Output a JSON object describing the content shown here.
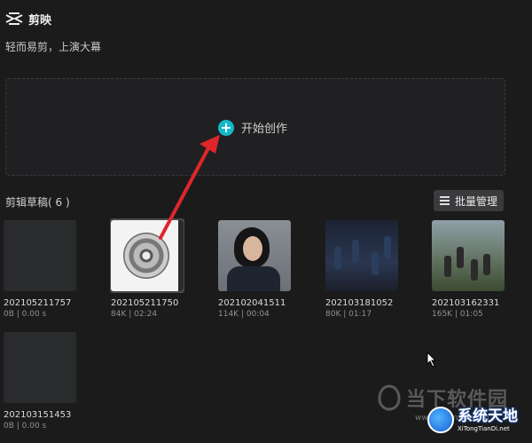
{
  "app": {
    "name": "剪映",
    "slogan": "轻而易剪，上演大幕"
  },
  "create": {
    "label": "开始创作"
  },
  "drafts": {
    "title": "剪辑草稿( 6 )",
    "batch_label": "批量管理",
    "items": [
      {
        "name": "202105211757",
        "meta": "0B | 0.00 s"
      },
      {
        "name": "202105211750",
        "meta": "84K | 02:24"
      },
      {
        "name": "202102041511",
        "meta": "114K | 00:04"
      },
      {
        "name": "202103181052",
        "meta": "80K | 01:17"
      },
      {
        "name": "202103162331",
        "meta": "165K | 01:05"
      },
      {
        "name": "202103151453",
        "meta": "0B | 0.00 s"
      }
    ]
  },
  "watermark": {
    "text": "当下软件园",
    "url": "www.downxia.com"
  },
  "badge": {
    "text": "系统天地",
    "url": "XiTongTianDi.net"
  },
  "colors": {
    "background": "#1b1b1c",
    "accent": "#14b8c7",
    "arrow": "#e0262a"
  }
}
